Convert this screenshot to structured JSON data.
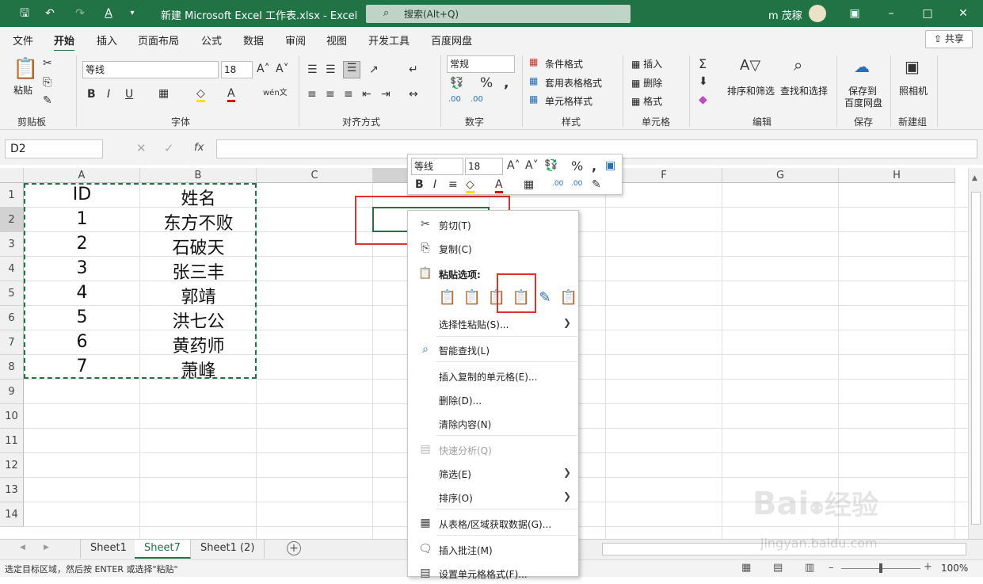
{
  "title_bar": {
    "title": "新建 Microsoft Excel 工作表.xlsx  -  Excel",
    "search_placeholder": "搜索(Alt+Q)",
    "user": "m 茂稼"
  },
  "tabs": [
    "文件",
    "开始",
    "插入",
    "页面布局",
    "公式",
    "数据",
    "审阅",
    "视图",
    "开发工具",
    "百度网盘"
  ],
  "share_label": "共享",
  "ribbon": {
    "paste": "粘贴",
    "font_name": "等线",
    "font_size": "18",
    "number_format": "常规",
    "conditional_format": "条件格式",
    "table_format": "套用表格格式",
    "cell_style": "单元格样式",
    "insert": "插入",
    "delete": "删除",
    "format": "格式",
    "sort_filter": "排序和筛选",
    "find_select": "查找和选择",
    "save_to": "保存到",
    "baidu_disk": "百度网盘",
    "camera": "照相机",
    "groups": [
      "剪贴板",
      "字体",
      "对齐方式",
      "数字",
      "样式",
      "单元格",
      "编辑",
      "保存",
      "新建组"
    ]
  },
  "formula_bar": {
    "name_box": "D2",
    "fx": "fx"
  },
  "columns": [
    "A",
    "B",
    "C",
    "D",
    "E",
    "F",
    "G",
    "H"
  ],
  "rows": [
    "1",
    "2",
    "3",
    "4",
    "5",
    "6",
    "7",
    "8",
    "9",
    "10",
    "11",
    "12",
    "13",
    "14"
  ],
  "cells": {
    "a": [
      "ID",
      "1",
      "2",
      "3",
      "4",
      "5",
      "6",
      "7"
    ],
    "b": [
      "姓名",
      "东方不败",
      "石破天",
      "张三丰",
      "郭靖",
      "洪七公",
      "黄药师",
      "萧峰"
    ]
  },
  "mini_toolbar": {
    "font": "等线",
    "size": "18"
  },
  "context_menu": {
    "cut": "剪切(T)",
    "copy": "复制(C)",
    "paste_options": "粘贴选项:",
    "paste_special": "选择性粘贴(S)...",
    "smart_lookup": "智能查找(L)",
    "insert_copied": "插入复制的单元格(E)...",
    "delete": "删除(D)...",
    "clear": "清除内容(N)",
    "quick_analysis": "快速分析(Q)",
    "filter": "筛选(E)",
    "sort": "排序(O)",
    "get_data": "从表格/区域获取数据(G)...",
    "insert_comment": "插入批注(M)",
    "format_cells": "设置单元格格式(F)..."
  },
  "sheets": [
    "Sheet1",
    "Sheet7",
    "Sheet1 (2)"
  ],
  "status": {
    "message": "选定目标区域，然后按 ENTER 或选择\"粘贴\"",
    "zoom": "100%"
  },
  "watermark": {
    "brand": "Bai",
    "brand2": "经验",
    "url": "jingyan.baidu.com"
  },
  "colors": {
    "excel_green": "#217346",
    "highlight_red": "#e0312e"
  }
}
